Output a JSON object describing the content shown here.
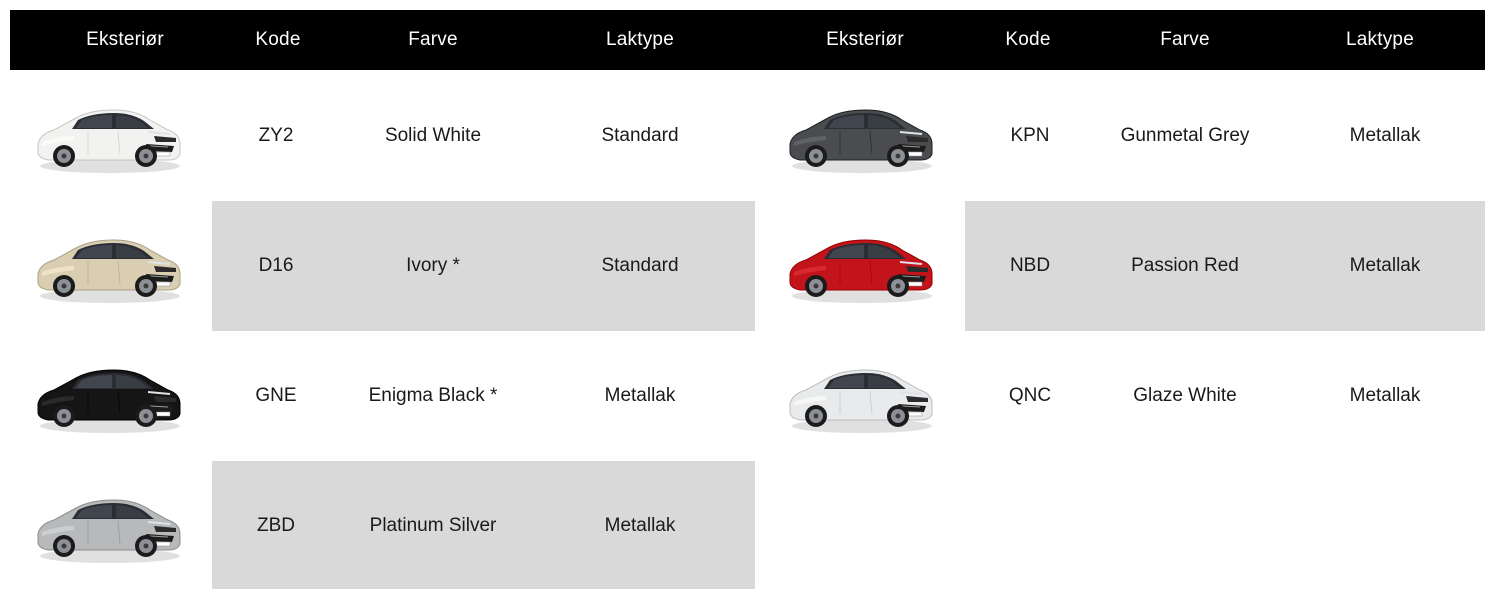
{
  "header": {
    "left": {
      "exterior": "Eksteriør",
      "code": "Kode",
      "color": "Farve",
      "paint": "Laktype"
    },
    "right": {
      "exterior": "Eksteriør",
      "code": "Kode",
      "color": "Farve",
      "paint": "Laktype"
    }
  },
  "left_rows": [
    {
      "code": "ZY2",
      "color": "Solid White",
      "paint": "Standard",
      "car_color": "#f2f2f0"
    },
    {
      "code": "D16",
      "color": "Ivory *",
      "paint": "Standard",
      "car_color": "#d9ceb2"
    },
    {
      "code": "GNE",
      "color": "Enigma Black *",
      "paint": "Metallak",
      "car_color": "#151515"
    },
    {
      "code": "ZBD",
      "color": "Platinum Silver",
      "paint": "Metallak",
      "car_color": "#b8b9bb"
    }
  ],
  "right_rows": [
    {
      "code": "KPN",
      "color": "Gunmetal Grey",
      "paint": "Metallak",
      "car_color": "#4a4c50"
    },
    {
      "code": "NBD",
      "color": "Passion Red",
      "paint": "Metallak",
      "car_color": "#c4141b"
    },
    {
      "code": "QNC",
      "color": "Glaze White",
      "paint": "Metallak",
      "car_color": "#e9eaec"
    }
  ],
  "colors": {
    "header_bg": "#000000",
    "shade": "#d9d9d9"
  }
}
